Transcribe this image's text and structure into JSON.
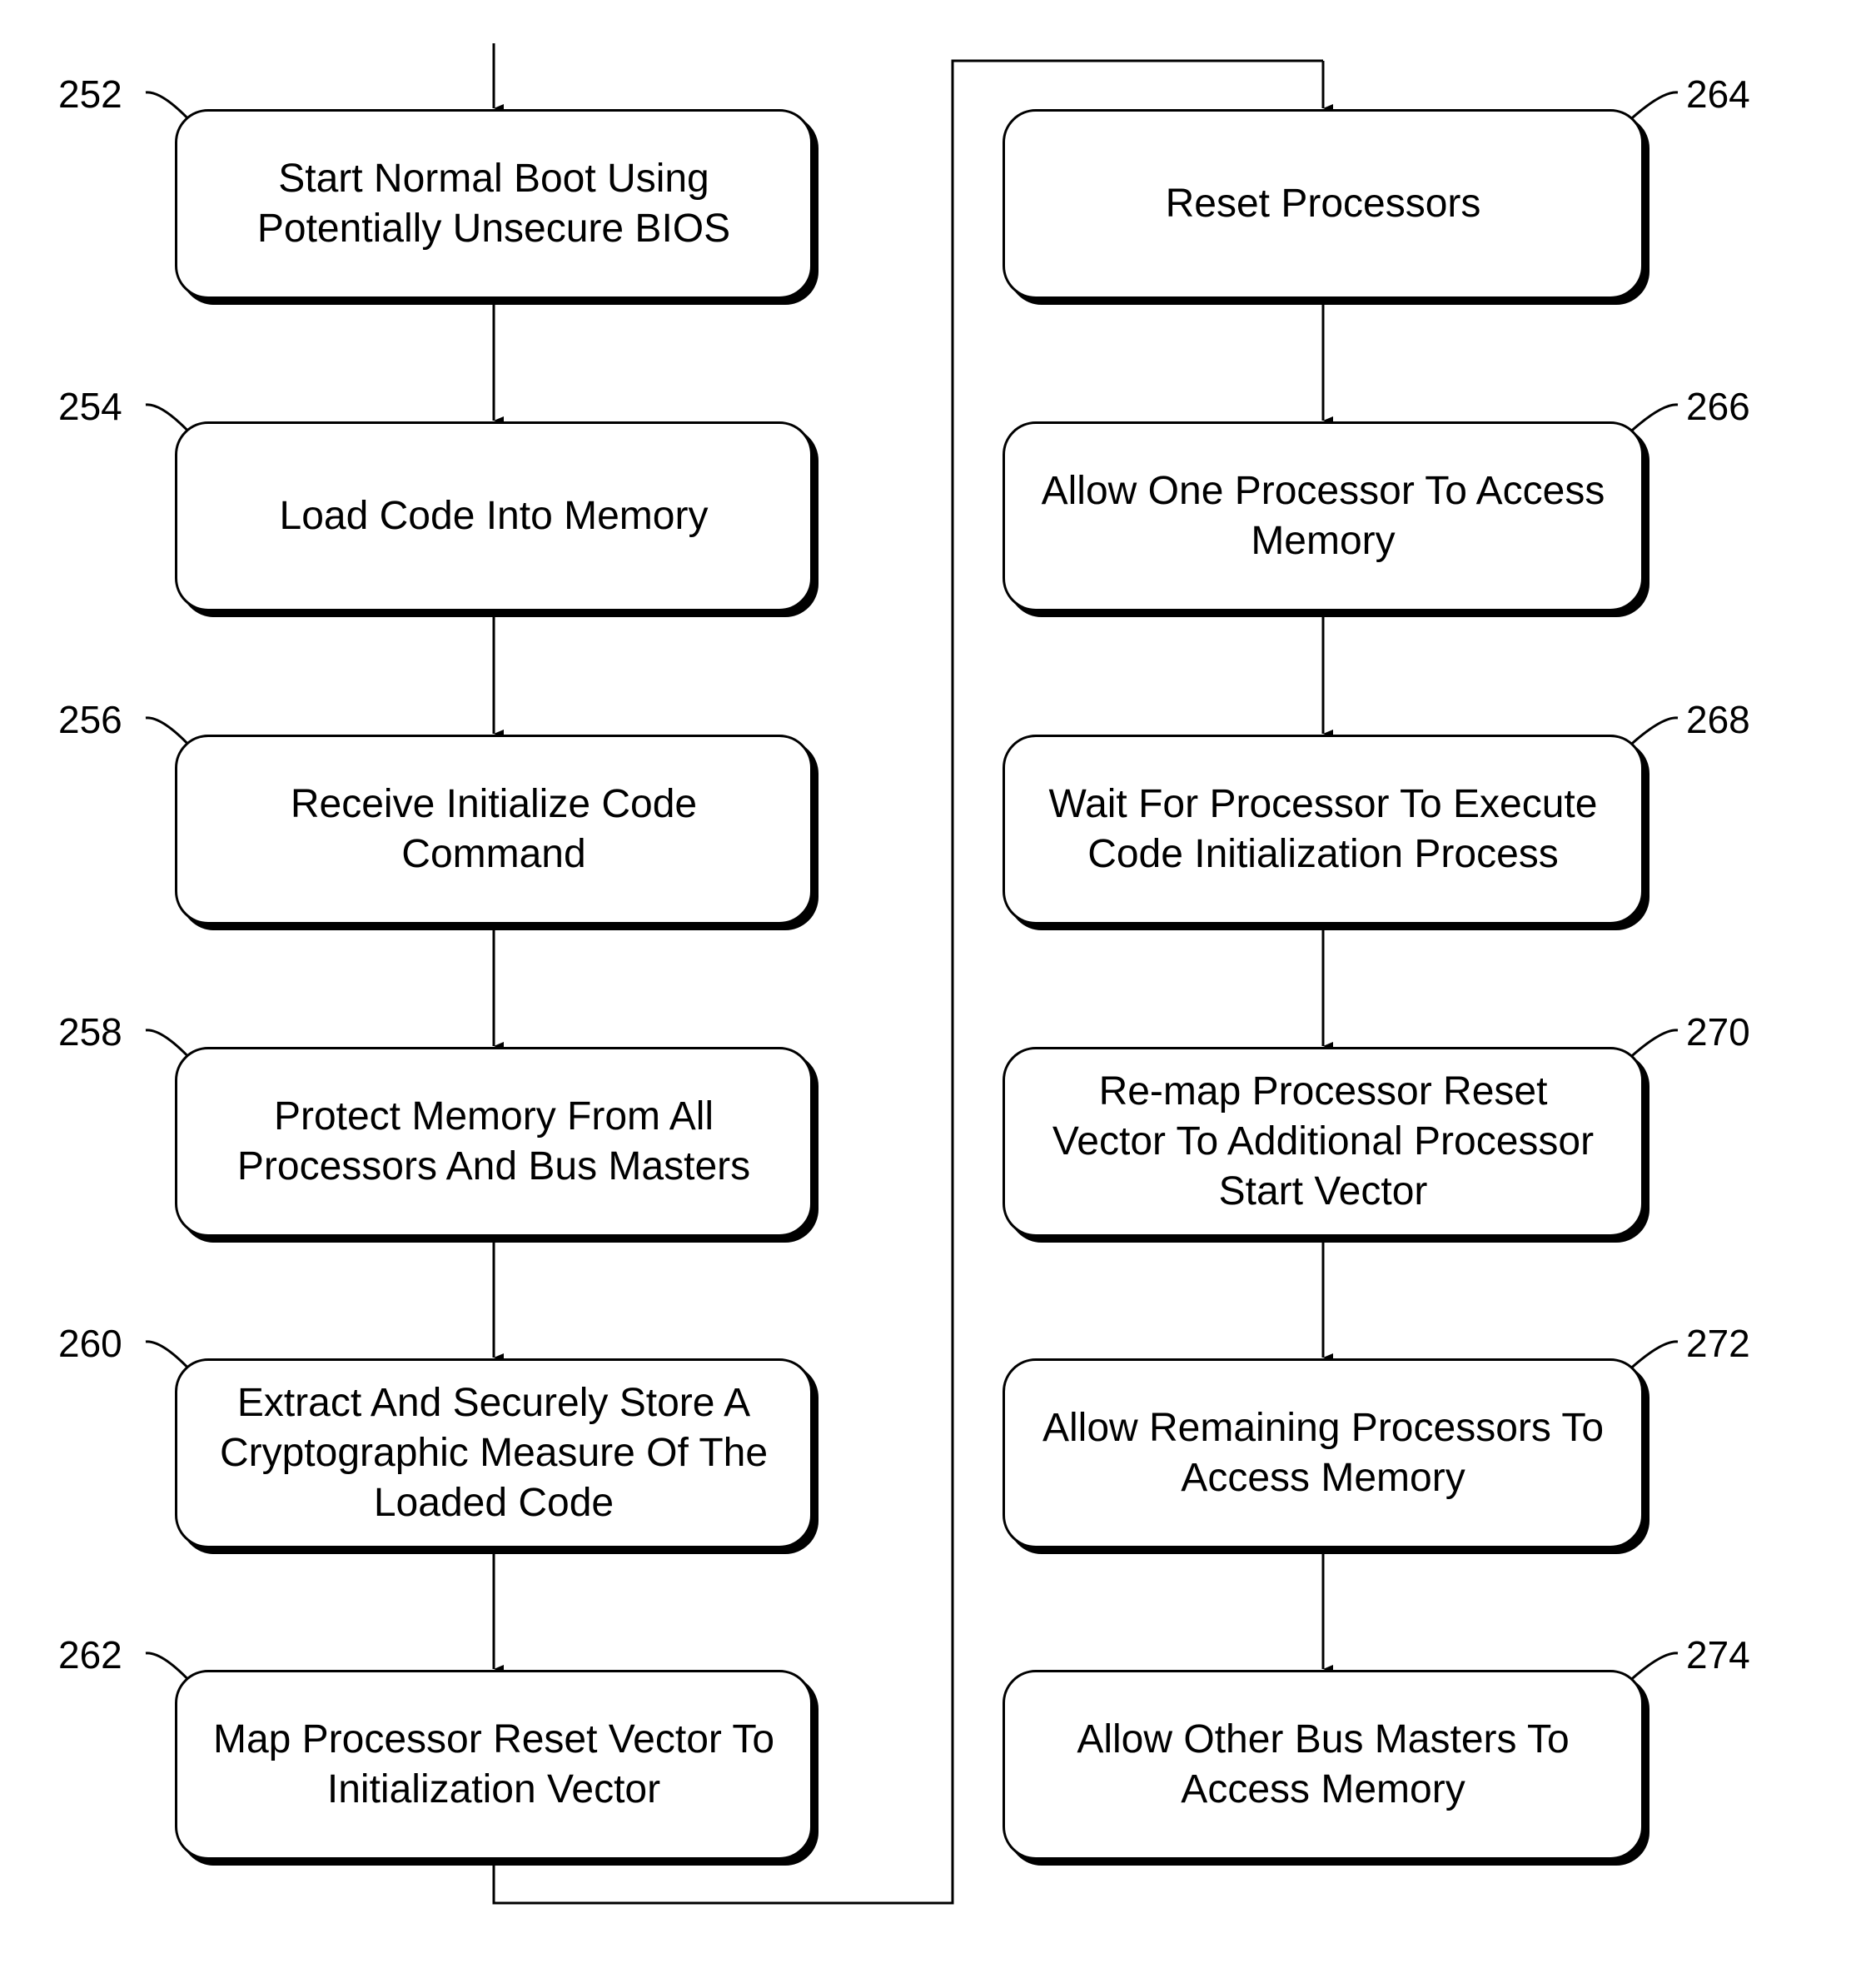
{
  "diagram": {
    "type": "flowchart",
    "left_column": [
      {
        "ref": "252",
        "text": "Start Normal Boot Using\nPotentially Unsecure BIOS"
      },
      {
        "ref": "254",
        "text": "Load Code Into Memory"
      },
      {
        "ref": "256",
        "text": "Receive Initialize Code\nCommand"
      },
      {
        "ref": "258",
        "text": "Protect Memory From All\nProcessors And Bus Masters"
      },
      {
        "ref": "260",
        "text": "Extract And Securely Store A\nCryptographic Measure Of The\nLoaded Code"
      },
      {
        "ref": "262",
        "text": "Map Processor Reset Vector To\nInitialization Vector"
      }
    ],
    "right_column": [
      {
        "ref": "264",
        "text": "Reset Processors"
      },
      {
        "ref": "266",
        "text": "Allow One Processor To Access\nMemory"
      },
      {
        "ref": "268",
        "text": "Wait For Processor To Execute\nCode Initialization Process"
      },
      {
        "ref": "270",
        "text": "Re-map Processor Reset\nVector To Additional Processor\nStart Vector"
      },
      {
        "ref": "272",
        "text": "Allow Remaining Processors To\nAccess Memory"
      },
      {
        "ref": "274",
        "text": "Allow Other Bus Masters To\nAccess Memory"
      }
    ],
    "edges": [
      [
        "entry",
        "252"
      ],
      [
        "252",
        "254"
      ],
      [
        "254",
        "256"
      ],
      [
        "256",
        "258"
      ],
      [
        "258",
        "260"
      ],
      [
        "260",
        "262"
      ],
      [
        "262",
        "264"
      ],
      [
        "264",
        "266"
      ],
      [
        "266",
        "268"
      ],
      [
        "268",
        "270"
      ],
      [
        "270",
        "272"
      ],
      [
        "272",
        "274"
      ]
    ]
  }
}
